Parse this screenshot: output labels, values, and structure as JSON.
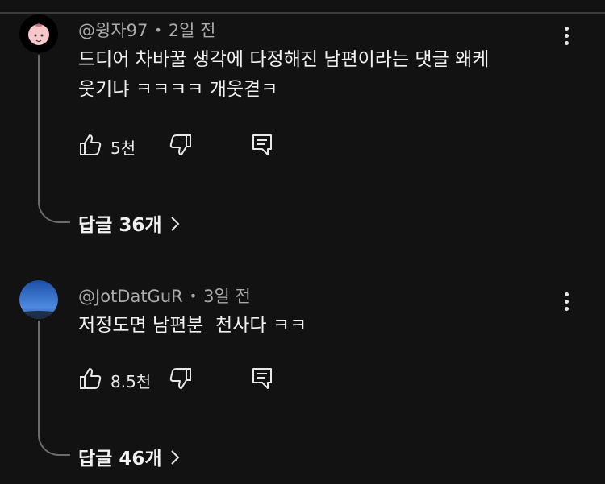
{
  "comments": [
    {
      "author": "@윙자97",
      "time": "2일 전",
      "text": "드디어 차바꿀 생각에 다정해진 남편이라는 댓글 왜케\n웃기냐 ㅋㅋㅋㅋ 개웃겯ㅋ",
      "likes": "5천",
      "replies": "답글 36개",
      "avatar_color": "#ffffff"
    },
    {
      "author": "@JotDatGuR",
      "time": "3일 전",
      "text": "저정도면 남편분  천사다 ㅋㅋ",
      "likes": "8.5천",
      "replies": "답글 46개",
      "avatar_color": "#3f7ad6"
    }
  ],
  "icons": {
    "more": "more-vert-icon",
    "like": "thumb-up-icon",
    "dislike": "thumb-down-icon",
    "reply": "comment-reply-icon",
    "chevron": "chevron-right-icon"
  }
}
